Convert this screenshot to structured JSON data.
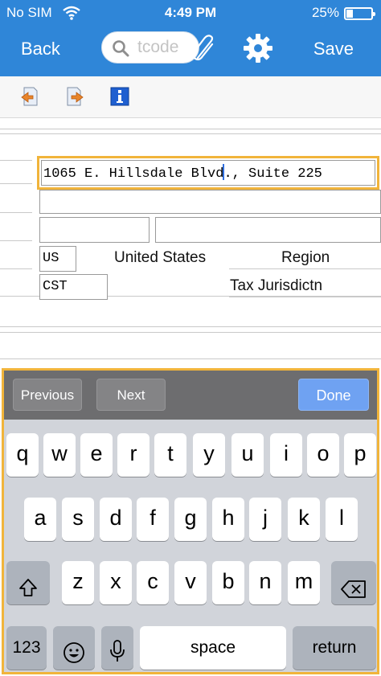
{
  "status_bar": {
    "carrier": "No SIM",
    "time": "4:49 PM",
    "battery_percent": "25%"
  },
  "nav": {
    "back_label": "Back",
    "search_placeholder": "tcode",
    "save_label": "Save"
  },
  "toolbar": {
    "icons": [
      "back-arrow-doc-icon",
      "forward-arrow-doc-icon",
      "info-icon"
    ]
  },
  "form": {
    "street_value_before_caret": "1065 E. Hillsdale Blvd",
    "street_value_after_caret": "., Suite 225",
    "street2_value": "",
    "postal_code_value": "",
    "city_value": "",
    "country_code": "US",
    "country_name": "United States",
    "region_label": "Region",
    "tax_code": "CST",
    "tax_label": "Tax Jurisdictn"
  },
  "keyboard": {
    "accessory": {
      "previous": "Previous",
      "next": "Next",
      "done": "Done"
    },
    "row1": [
      "q",
      "w",
      "e",
      "r",
      "t",
      "y",
      "u",
      "i",
      "o",
      "p"
    ],
    "row2": [
      "a",
      "s",
      "d",
      "f",
      "g",
      "h",
      "j",
      "k",
      "l"
    ],
    "row3": [
      "z",
      "x",
      "c",
      "v",
      "b",
      "n",
      "m"
    ],
    "numbers_key": "123",
    "space_key": "space",
    "return_key": "return"
  },
  "colors": {
    "nav_blue": "#2f86d8",
    "highlight_orange": "#f1b43b",
    "done_blue": "#6fa2f2",
    "caret_blue": "#2f6fe0"
  }
}
